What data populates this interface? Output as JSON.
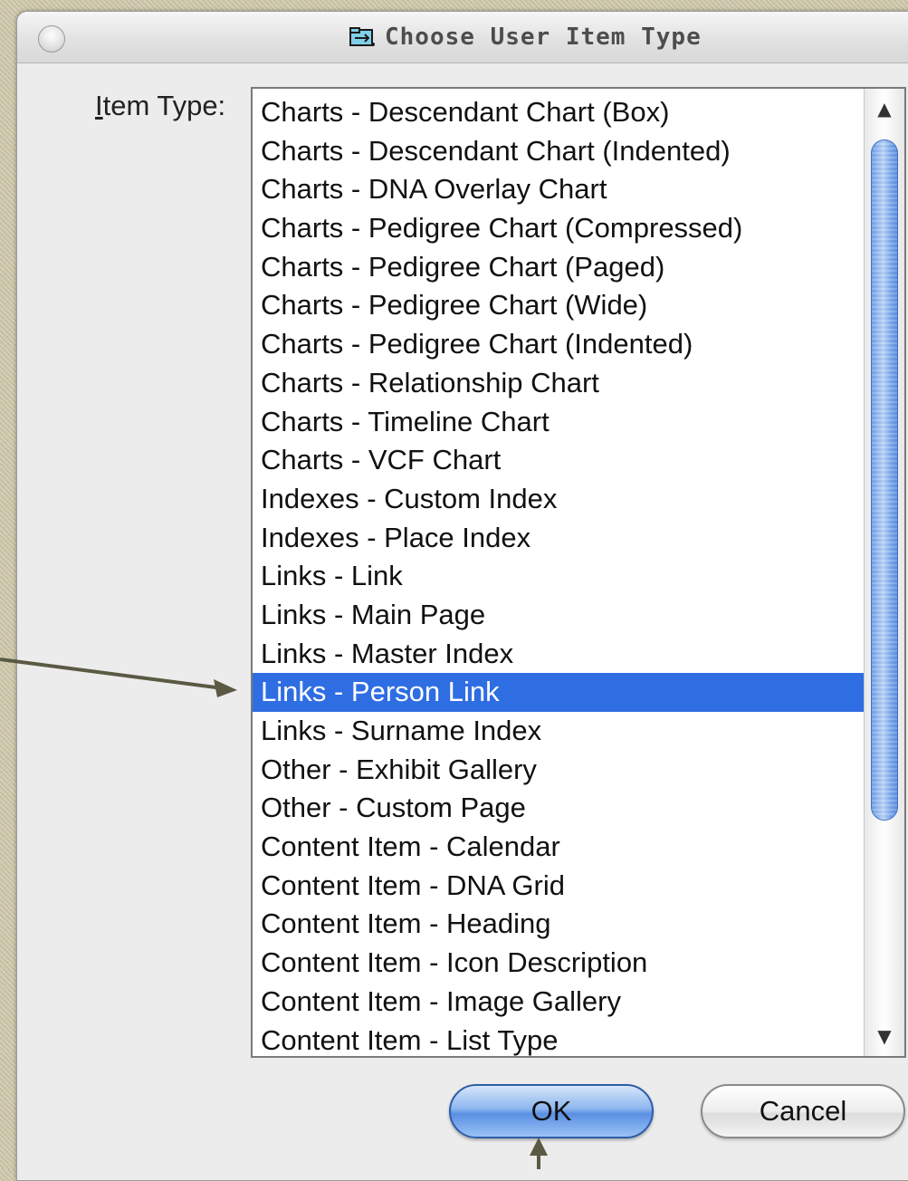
{
  "window": {
    "title": "Choose User Item Type",
    "icon": "folder-icon"
  },
  "form": {
    "label_accel": "I",
    "label_rest": "tem Type:"
  },
  "list": {
    "items": [
      "Charts - Descendant Chart (Box)",
      "Charts - Descendant Chart (Indented)",
      "Charts - DNA Overlay Chart",
      "Charts - Pedigree Chart (Compressed)",
      "Charts - Pedigree Chart (Paged)",
      "Charts - Pedigree Chart (Wide)",
      "Charts - Pedigree Chart (Indented)",
      "Charts - Relationship Chart",
      "Charts - Timeline Chart",
      "Charts - VCF Chart",
      "Indexes - Custom Index",
      "Indexes - Place Index",
      "Links - Link",
      "Links - Main Page",
      "Links - Master Index",
      "Links - Person Link",
      "Links - Surname Index",
      "Other - Exhibit Gallery",
      "Other - Custom Page",
      "Content Item - Calendar",
      "Content Item - DNA Grid",
      "Content Item - Heading",
      "Content Item - Icon Description",
      "Content Item - Image Gallery",
      "Content Item - List Type"
    ],
    "selected_index": 15,
    "scroll_up_glyph": "▲",
    "scroll_down_glyph": "▼"
  },
  "buttons": {
    "ok": "OK",
    "cancel": "Cancel"
  },
  "colors": {
    "selection": "#2f6de3",
    "annotation_arrow": "#5a5a44"
  }
}
